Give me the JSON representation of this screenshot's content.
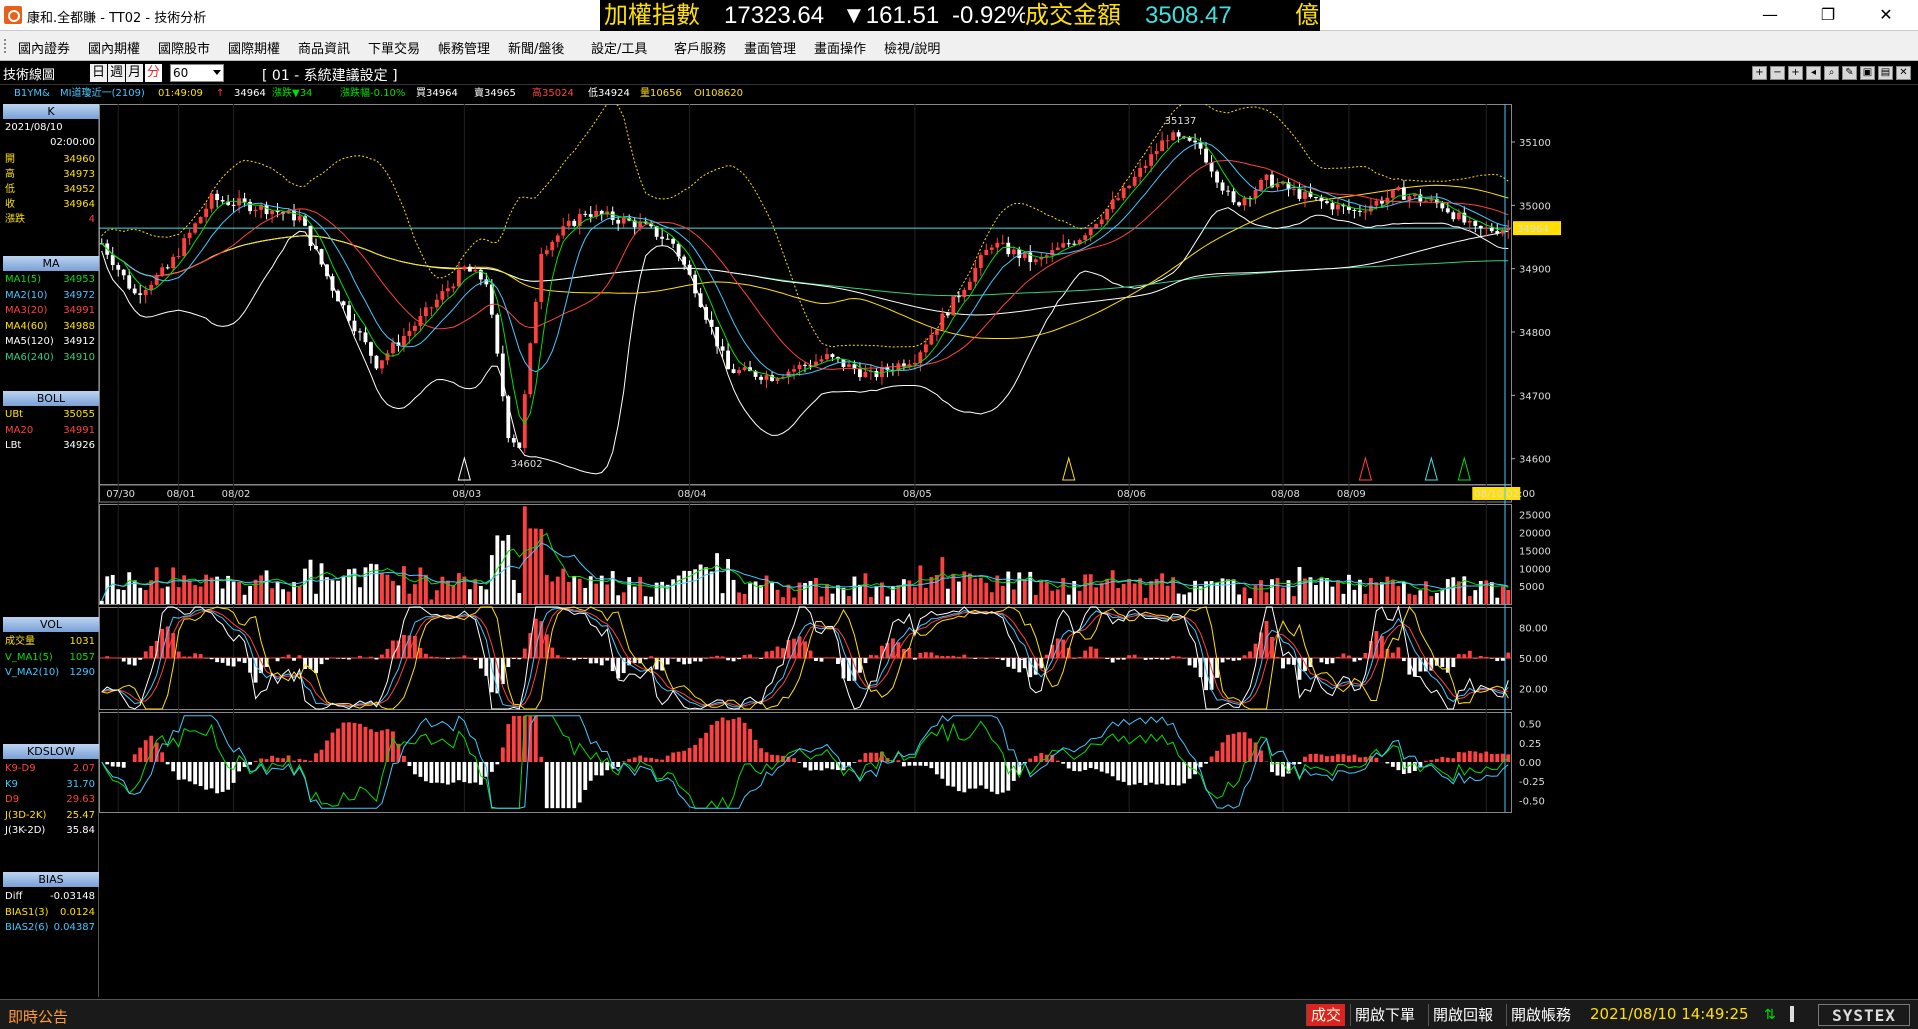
{
  "window": {
    "title": "康和.全都賺 - TT02 - 技術分析",
    "minimize": "—",
    "maximize": "❐",
    "close": "✕"
  },
  "ticker": {
    "index_name": "加權指數",
    "index_value": "17323.64",
    "change": "▼161.51",
    "change_pct": "-0.92%",
    "volume_label": "成交金額",
    "volume_value": "3508.47",
    "volume_unit": "億"
  },
  "menu": [
    "國內證券",
    "國內期權",
    "國際股市",
    "國際期權",
    "商品資訊",
    "下單交易",
    "帳務管理",
    "新聞/盤後",
    "設定/工具",
    "客戶服務",
    "畫面管理",
    "畫面操作",
    "檢視/說明"
  ],
  "chart_toolbar": {
    "panel_title": "技術線圖",
    "periods": [
      "日",
      "週",
      "月",
      "分"
    ],
    "active_period": "分",
    "interval": "60",
    "setting_label": "[ 01 - 系統建議設定 ]"
  },
  "info_row": {
    "symbol": "B1YM&",
    "contract": "MI道瓊近一(2109)",
    "time": "01:49:09",
    "last": "34964",
    "change": "漲跌▼34",
    "change_pct": "漲跌幅-0.10%",
    "buy": "買34964",
    "sell": "賣34965",
    "high": "高35024",
    "low": "低34924",
    "volume": "量10656",
    "oi": "OI108620"
  },
  "left_panel": {
    "k": {
      "title": "K",
      "date": "2021/08/10",
      "time": "02:00:00",
      "rows": [
        {
          "label": "開",
          "value": "34960"
        },
        {
          "label": "高",
          "value": "34973"
        },
        {
          "label": "低",
          "value": "34952"
        },
        {
          "label": "收",
          "value": "34964"
        },
        {
          "label": "漲跌",
          "value": "4"
        }
      ]
    },
    "ma": {
      "title": "MA",
      "rows": [
        {
          "label": "MA1(5)",
          "value": "34953",
          "color": "#00e000"
        },
        {
          "label": "MA2(10)",
          "value": "34972",
          "color": "#40c8ff"
        },
        {
          "label": "MA3(20)",
          "value": "34991",
          "color": "#ff4040"
        },
        {
          "label": "MA4(60)",
          "value": "34988",
          "color": "#ffe000"
        },
        {
          "label": "MA5(120)",
          "value": "34912",
          "color": "#ffffff"
        },
        {
          "label": "MA6(240)",
          "value": "34910",
          "color": "#30d080"
        }
      ]
    },
    "boll": {
      "title": "BOLL",
      "rows": [
        {
          "label": "UBt",
          "value": "35055",
          "color": "#ffe000"
        },
        {
          "label": "MA20",
          "value": "34991",
          "color": "#ff4040"
        },
        {
          "label": "LBt",
          "value": "34926",
          "color": "#ffffff"
        }
      ]
    },
    "vol": {
      "title": "VOL",
      "rows": [
        {
          "label": "成交量",
          "value": "1031",
          "color": "#ffe000"
        },
        {
          "label": "V_MA1(5)",
          "value": "1057",
          "color": "#00e000"
        },
        {
          "label": "V_MA2(10)",
          "value": "1290",
          "color": "#40c8ff"
        }
      ]
    },
    "kd": {
      "title": "KDSLOW",
      "rows": [
        {
          "label": "K9-D9",
          "value": "2.07",
          "color": "#ff4040"
        },
        {
          "label": "K9",
          "value": "31.70",
          "color": "#40c8ff"
        },
        {
          "label": "D9",
          "value": "29.63",
          "color": "#ff4040"
        },
        {
          "label": "J(3D-2K)",
          "value": "25.47",
          "color": "#ffe000"
        },
        {
          "label": "J(3K-2D)",
          "value": "35.84",
          "color": "#ffffff"
        }
      ]
    },
    "bias": {
      "title": "BIAS",
      "rows": [
        {
          "label": "Diff",
          "value": "-0.03148",
          "color": "#ffffff"
        },
        {
          "label": "BIAS1(3)",
          "value": "0.0124",
          "color": "#ffe000"
        },
        {
          "label": "BIAS2(6)",
          "value": "0.04387",
          "color": "#40c8ff"
        }
      ]
    }
  },
  "status_bar": {
    "announce": "即時公告",
    "deal": "成交",
    "buttons": [
      "開啟下單",
      "開啟回報",
      "開啟帳務"
    ],
    "datetime": "2021/08/10 14:49:25",
    "brand": "SYSTEX"
  },
  "chart_data": {
    "type": "candlestick",
    "price": {
      "ymin": 34560,
      "ymax": 35160,
      "ticks": [
        34600,
        34700,
        34800,
        34900,
        35000,
        35100
      ],
      "last_price": 34964,
      "high_label": "35137",
      "low_label": "34602",
      "dates": [
        "07/30",
        "08/01",
        "08/02",
        "08/03",
        "08/04",
        "08/05",
        "08/06",
        "08/08",
        "08/09",
        "08/10 02:00"
      ]
    },
    "volume": {
      "ymax": 28000,
      "ticks": [
        5000,
        10000,
        15000,
        20000,
        25000
      ]
    },
    "kd": {
      "ymin": 0,
      "ymax": 100,
      "ticks": [
        20.0,
        50.0,
        80.0
      ]
    },
    "bias": {
      "ymin": -0.65,
      "ymax": 0.65,
      "ticks": [
        0.5,
        0.25,
        0.0,
        -0.25,
        -0.5
      ]
    }
  },
  "colors": {
    "up": "#ff4040",
    "down": "#ffffff",
    "grid": "#222",
    "axis": "#ddd"
  }
}
